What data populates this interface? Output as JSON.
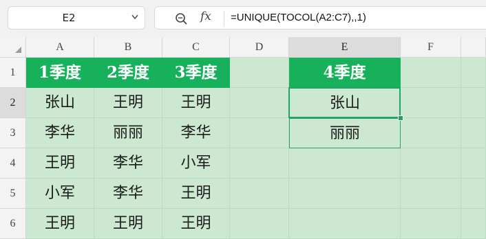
{
  "name_box": {
    "cell_ref": "E2"
  },
  "formula_bar": {
    "icons": [
      "zoom-icon",
      "fx-icon"
    ],
    "fx_label": "fx",
    "formula": "=UNIQUE(TOCOL(A2:C7),,1)"
  },
  "columns": [
    "A",
    "B",
    "C",
    "D",
    "E",
    "F"
  ],
  "rows": [
    "1",
    "2",
    "3",
    "4",
    "5",
    "6"
  ],
  "selected": {
    "column": "E",
    "row": "2"
  },
  "colors": {
    "header_fill": "#16b15a",
    "sheet_fill": "#cde8d1",
    "selection": "#21a366"
  },
  "cells": {
    "A1": "1季度",
    "B1": "2季度",
    "C1": "3季度",
    "E1": "4季度",
    "A2": "张山",
    "B2": "王明",
    "C2": "王明",
    "E2": "张山",
    "A3": "李华",
    "B3": "丽丽",
    "C3": "李华",
    "E3": "丽丽",
    "A4": "王明",
    "B4": "李华",
    "C4": "小军",
    "A5": "小军",
    "B5": "李华",
    "C5": "王明",
    "A6": "王明",
    "B6": "王明",
    "C6": "王明"
  }
}
